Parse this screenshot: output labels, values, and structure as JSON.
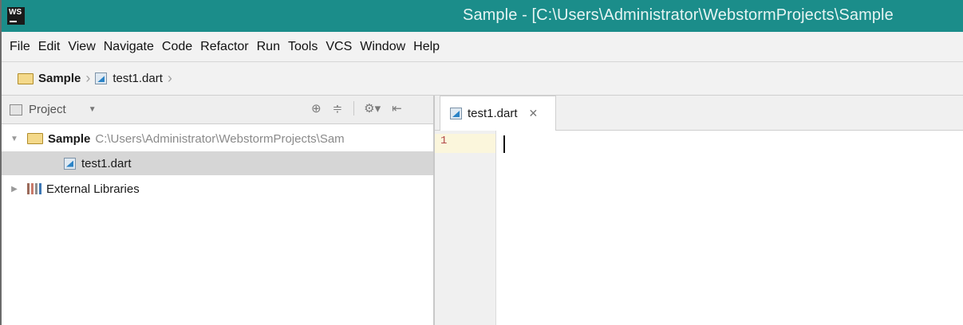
{
  "app": {
    "logo_text": "WS",
    "title": "Sample - [C:\\Users\\Administrator\\WebstormProjects\\Sample"
  },
  "menu": [
    "File",
    "Edit",
    "View",
    "Navigate",
    "Code",
    "Refactor",
    "Run",
    "Tools",
    "VCS",
    "Window",
    "Help"
  ],
  "breadcrumb": {
    "project": "Sample",
    "file": "test1.dart"
  },
  "project_panel": {
    "title": "Project",
    "tree": [
      {
        "name": "Sample",
        "path": "C:\\Users\\Administrator\\WebstormProjects\\Sam"
      },
      {
        "name": "test1.dart"
      },
      {
        "name": "External Libraries"
      }
    ]
  },
  "editor": {
    "tab_label": "test1.dart",
    "line_numbers": [
      "1"
    ]
  },
  "colors": {
    "titlebar": "#1b8d8a",
    "line_number": "#b24a4a"
  }
}
